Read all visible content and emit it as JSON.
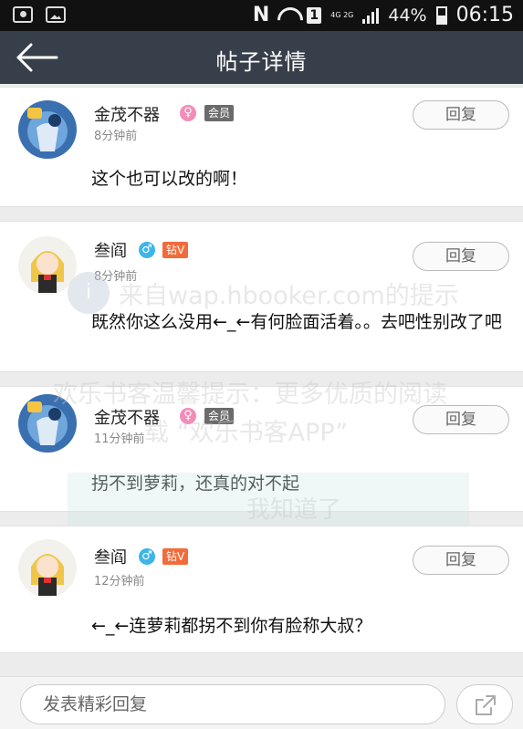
{
  "status_bar": {
    "left_icons": [
      "camera-icon",
      "image-icon"
    ],
    "carrier_letter": "N",
    "sim_label": "1",
    "network_label": "4G 2G",
    "battery_percent": "44%",
    "time": "06:15"
  },
  "header": {
    "title": "帖子详情",
    "back_icon": "arrow-left-icon"
  },
  "posts": [
    {
      "username": "金茂不器",
      "gender_symbol": "♀",
      "badge": "会员",
      "time": "8分钟前",
      "reply_label": "回复",
      "content": "这个也可以改的啊！"
    },
    {
      "username": "叁阎",
      "gender_symbol": "♂",
      "badge": "钻V",
      "time": "8分钟前",
      "reply_label": "回复",
      "content": "既然你这么没用←_←有何脸面活着。。去吧性别改了吧"
    },
    {
      "username": "金茂不器",
      "gender_symbol": "♀",
      "badge": "会员",
      "time": "11分钟前",
      "reply_label": "回复",
      "content": "拐不到萝莉，还真的对不起"
    },
    {
      "username": "叁阎",
      "gender_symbol": "♂",
      "badge": "钻V",
      "time": "12分钟前",
      "reply_label": "回复",
      "content": "←_←连萝莉都拐不到你有脸称大叔？"
    }
  ],
  "watermark": {
    "line1": "来自wap.hbooker.com的提示",
    "line2": "欢乐书客温馨提示：更多优质的阅读",
    "line3": "载 “欢乐书客APP”",
    "button": "我知道了",
    "info_symbol": "i"
  },
  "bottom_bar": {
    "input_placeholder": "发表精彩回复",
    "share_icon": "share-icon"
  },
  "colors": {
    "header_bg": "#37404a",
    "female_badge": "#f28cb8",
    "male_badge": "#3cb6e8",
    "diamond_badge": "#f26b3a",
    "member_badge": "#6b6b6b"
  }
}
